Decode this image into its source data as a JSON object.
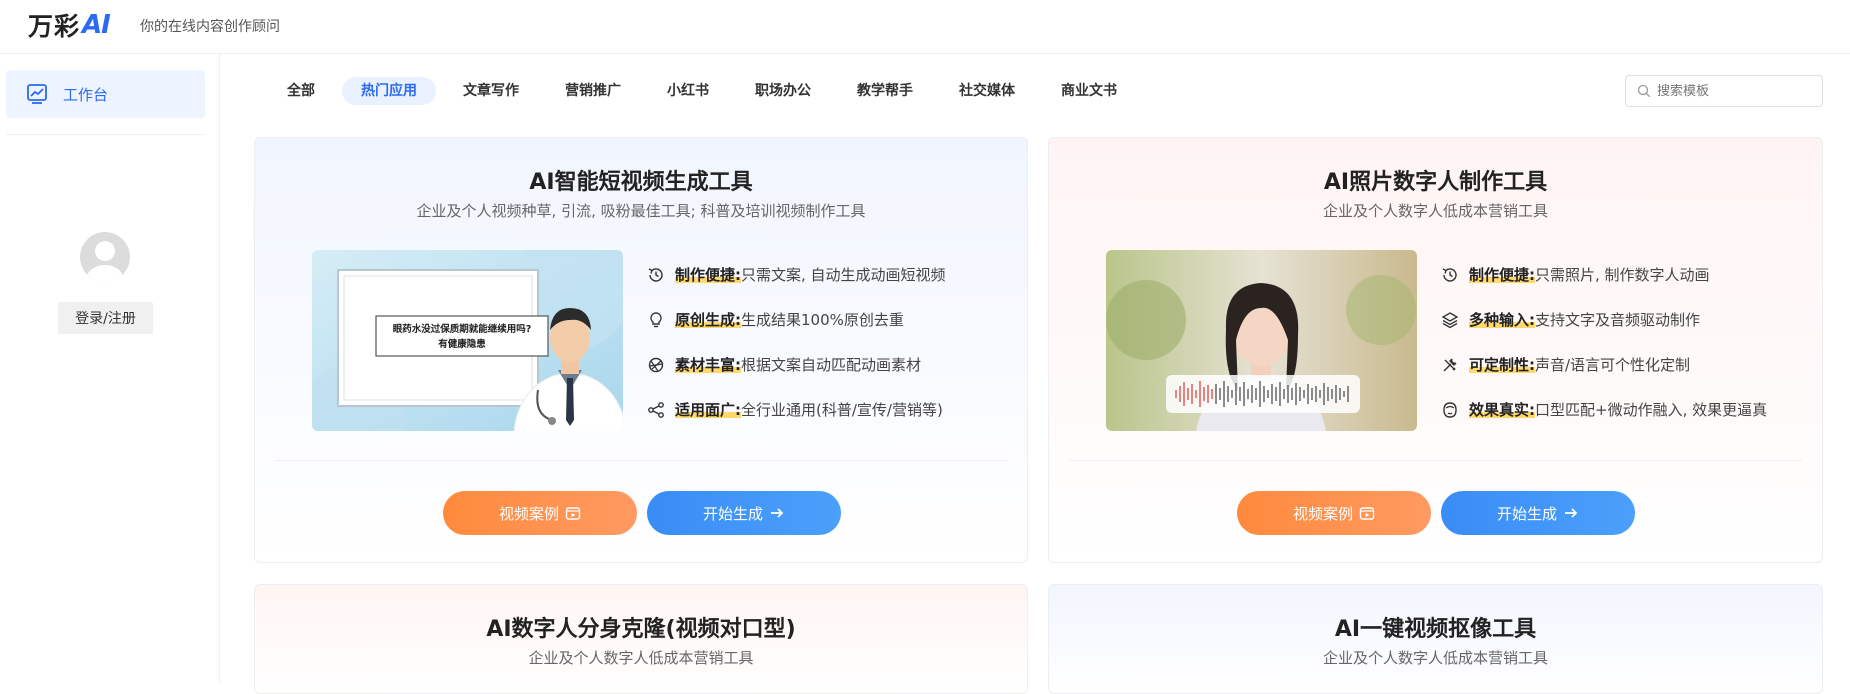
{
  "header": {
    "logo_text": "万彩",
    "logo_ai": "AI",
    "tagline": "你的在线内容创作顾问"
  },
  "sidebar": {
    "items": [
      {
        "label": "工作台",
        "icon": "chart-line-icon"
      }
    ],
    "login_label": "登录/注册"
  },
  "tabs": [
    {
      "label": "全部",
      "active": false
    },
    {
      "label": "热门应用",
      "active": true
    },
    {
      "label": "文章写作",
      "active": false
    },
    {
      "label": "营销推广",
      "active": false
    },
    {
      "label": "小红书",
      "active": false
    },
    {
      "label": "职场办公",
      "active": false
    },
    {
      "label": "教学帮手",
      "active": false
    },
    {
      "label": "社交媒体",
      "active": false
    },
    {
      "label": "商业文书",
      "active": false
    }
  ],
  "search": {
    "placeholder": "搜索模板"
  },
  "cards": [
    {
      "title": "AI智能短视频生成工具",
      "subtitle": "企业及个人视频种草, 引流, 吸粉最佳工具; 科普及培训视频制作工具",
      "image_text_1": "眼药水没过保质期就能继续用吗?",
      "image_text_2": "有健康隐患",
      "features": [
        {
          "name": "制作便捷:",
          "desc": "只需文案, 自动生成动画短视频",
          "icon": "clock-icon"
        },
        {
          "name": "原创生成:",
          "desc": "生成结果100%原创去重",
          "icon": "bulb-icon"
        },
        {
          "name": "素材丰富:",
          "desc": "根据文案自动匹配动画素材",
          "icon": "aperture-icon"
        },
        {
          "name": "适用面广:",
          "desc": "全行业通用(科普/宣传/营销等)",
          "icon": "share-icon"
        }
      ],
      "btn_case": "视频案例",
      "btn_start": "开始生成"
    },
    {
      "title": "AI照片数字人制作工具",
      "subtitle": "企业及个人数字人低成本营销工具",
      "features": [
        {
          "name": "制作便捷:",
          "desc": "只需照片, 制作数字人动画",
          "icon": "clock-icon"
        },
        {
          "name": "多种输入:",
          "desc": "支持文字及音频驱动制作",
          "icon": "layers-icon"
        },
        {
          "name": "可定制性:",
          "desc": "声音/语言可个性化定制",
          "icon": "tools-icon"
        },
        {
          "name": "效果真实:",
          "desc": "口型匹配+微动作融入, 效果更逼真",
          "icon": "face-icon"
        }
      ],
      "btn_case": "视频案例",
      "btn_start": "开始生成"
    },
    {
      "title": "AI数字人分身克隆(视频对口型)",
      "subtitle": "企业及个人数字人低成本营销工具"
    },
    {
      "title": "AI一键视频抠像工具",
      "subtitle": "企业及个人数字人低成本营销工具"
    }
  ],
  "colors": {
    "accent": "#2a6bf2",
    "orange": "#ff8a3c",
    "blue": "#3a8cf6",
    "highlight": "#ffd86b"
  }
}
